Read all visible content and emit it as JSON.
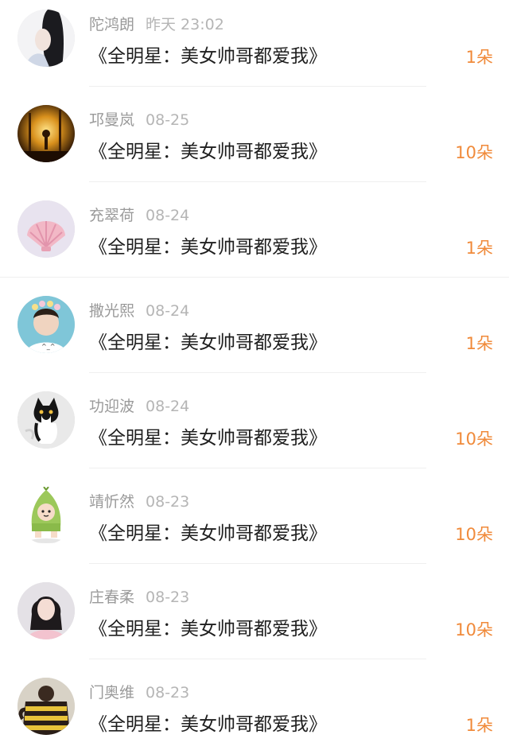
{
  "entries": [
    {
      "name": "陀鸿朗",
      "time": "昨天 23:02",
      "gift": "《全明星：美女帅哥都爱我》",
      "count": "1朵"
    },
    {
      "name": "邛曼岚",
      "time": "08-25",
      "gift": "《全明星：美女帅哥都爱我》",
      "count": "10朵"
    },
    {
      "name": "充翠荷",
      "time": "08-24",
      "gift": "《全明星：美女帅哥都爱我》",
      "count": "1朵"
    },
    {
      "name": "撒光熙",
      "time": "08-24",
      "gift": "《全明星：美女帅哥都爱我》",
      "count": "1朵"
    },
    {
      "name": "功迎波",
      "time": "08-24",
      "gift": "《全明星：美女帅哥都爱我》",
      "count": "10朵"
    },
    {
      "name": "靖忻然",
      "time": "08-23",
      "gift": "《全明星：美女帅哥都爱我》",
      "count": "10朵"
    },
    {
      "name": "庄春柔",
      "time": "08-23",
      "gift": "《全明星：美女帅哥都爱我》",
      "count": "10朵"
    },
    {
      "name": "门奥维",
      "time": "08-23",
      "gift": "《全明星：美女帅哥都爱我》",
      "count": "1朵"
    }
  ],
  "colors": {
    "accent": "#f08a3a",
    "name_text": "#9a9a9a",
    "body_text": "#1f1f1f"
  }
}
